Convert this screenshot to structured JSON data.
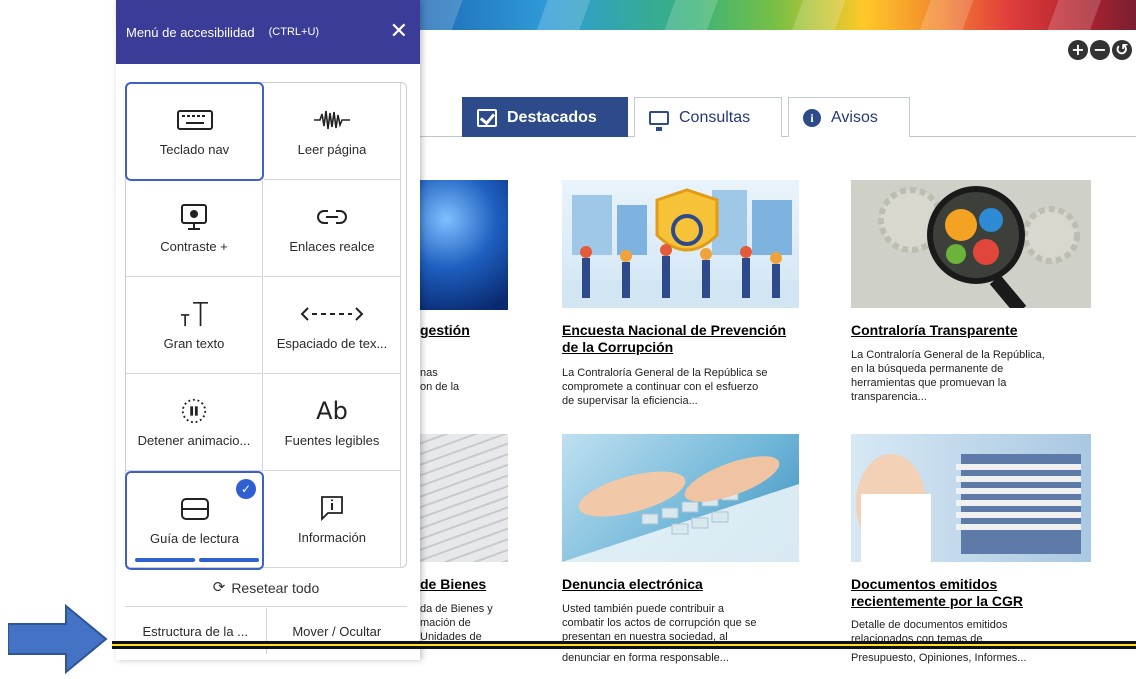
{
  "panel": {
    "title": "Menú de accesibilidad",
    "shortcut": "(CTRL+U)",
    "close_symbol": "✕",
    "tiles": [
      {
        "label": "Teclado nav",
        "icon": "keyboard-icon",
        "selected": true
      },
      {
        "label": "Leer página",
        "icon": "sound-wave-icon",
        "selected": false
      },
      {
        "label": "Contraste +",
        "icon": "monitor-icon",
        "selected": false
      },
      {
        "label": "Enlaces realce",
        "icon": "link-icon",
        "selected": false
      },
      {
        "label": "Gran texto",
        "icon": "text-size-icon",
        "selected": false
      },
      {
        "label": "Espaciado de tex...",
        "icon": "spacing-arrows-icon",
        "selected": false
      },
      {
        "label": "Detener animacio...",
        "icon": "pause-icon",
        "selected": false
      },
      {
        "label": "Fuentes legibles",
        "icon": "font-ab-icon",
        "glyph": "Ab",
        "selected": false
      },
      {
        "label": "Guía de lectura",
        "icon": "reading-guide-icon",
        "selected": true
      },
      {
        "label": "Información",
        "icon": "info-bubble-icon",
        "selected": false
      }
    ],
    "reset_label": "Resetear todo",
    "bottom": [
      "Estructura de la ...",
      "Mover / Ocultar"
    ]
  },
  "tabs": [
    {
      "label": "Destacados",
      "icon": "checkbox-icon",
      "active": true
    },
    {
      "label": "Consultas",
      "icon": "monitor-icon",
      "active": false
    },
    {
      "label": "Avisos",
      "icon": "info-icon",
      "active": false
    }
  ],
  "font_controls": [
    "+",
    "−",
    "↺"
  ],
  "cards_top": [
    {
      "title": "gestión",
      "lines": [
        "nas",
        "on de la"
      ]
    },
    {
      "title": "Encuesta Nacional de Prevención de la Corrupción",
      "lines": [
        "La Contraloría General de la República se",
        "compromete a continuar con el esfuerzo",
        "de supervisar la eficiencia..."
      ]
    },
    {
      "title": "Contraloría Transparente",
      "lines": [
        "La Contraloría General de la República,",
        "en la búsqueda permanente de",
        "herramientas que promuevan la",
        "transparencia..."
      ]
    }
  ],
  "cards_bottom": [
    {
      "title": "de Bienes",
      "lines": [
        "da de Bienes y",
        "mación de",
        "Unidades de"
      ]
    },
    {
      "title": "Denuncia electrónica",
      "lines": [
        "Usted también puede contribuir a",
        "combatir los actos de corrupción que se",
        "presentan en nuestra sociedad, al",
        "denunciar en forma responsable..."
      ]
    },
    {
      "title": "Documentos emitidos recientemente por la CGR",
      "lines": [
        "Detalle de documentos emitidos",
        "relacionados con temas de",
        "Presupuesto, Opiniones, Informes..."
      ]
    }
  ],
  "colors": {
    "panel_header": "#3a3c98",
    "tab_active": "#2d4a8a",
    "accent": "#2f5fd0",
    "guide": "#ffe11a",
    "arrow": "#4472c4"
  }
}
